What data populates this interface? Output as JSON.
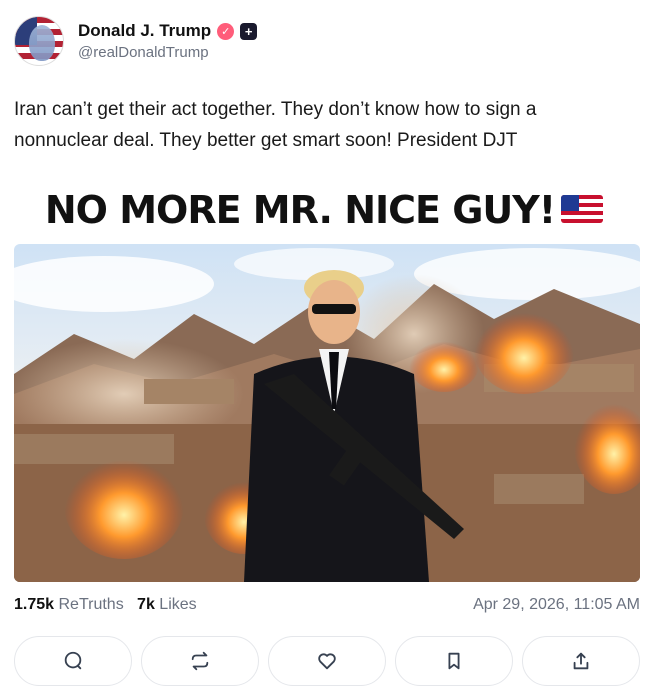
{
  "author": {
    "display_name": "Donald J. Trump",
    "handle": "@realDonaldTrump",
    "avatar_icon": "avatar-flag-portrait",
    "verified_icon": "verified-badge-icon",
    "plus_icon": "plus-badge-icon"
  },
  "post": {
    "text": "Iran can’t get their act together. They don’t know how to sign a nonnuclear deal. They better get smart soon! President DJT"
  },
  "media": {
    "headline": "NO MORE MR. NICE GUY!",
    "flag_icon": "us-flag-icon"
  },
  "stats": {
    "retruths_count": "1.75k",
    "retruths_label": "ReTruths",
    "likes_count": "7k",
    "likes_label": "Likes",
    "timestamp": "Apr 29, 2026, 11:05 AM"
  },
  "actions": [
    {
      "icon": "reply-icon"
    },
    {
      "icon": "retruth-icon"
    },
    {
      "icon": "like-icon"
    },
    {
      "icon": "bookmark-icon"
    },
    {
      "icon": "share-icon"
    }
  ],
  "colors": {
    "verified": "#ff5d7a",
    "text_secondary": "#6b7280",
    "border": "#e5e7eb"
  }
}
